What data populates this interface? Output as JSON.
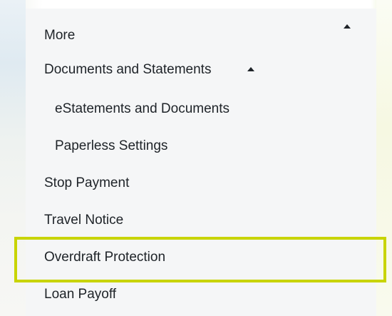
{
  "menu": {
    "more_label": "More",
    "documents_label": "Documents and Statements",
    "estatements_label": "eStatements and Documents",
    "paperless_label": "Paperless Settings",
    "stop_payment_label": "Stop Payment",
    "travel_notice_label": "Travel Notice",
    "overdraft_label": "Overdraft Protection",
    "loan_payoff_label": "Loan Payoff"
  },
  "colors": {
    "highlight": "#c8d400",
    "panel_background": "#f5f6f7",
    "text": "#1e2328"
  },
  "icons": {
    "more_toggle": "chevron-up-icon",
    "documents_toggle": "chevron-up-icon"
  }
}
